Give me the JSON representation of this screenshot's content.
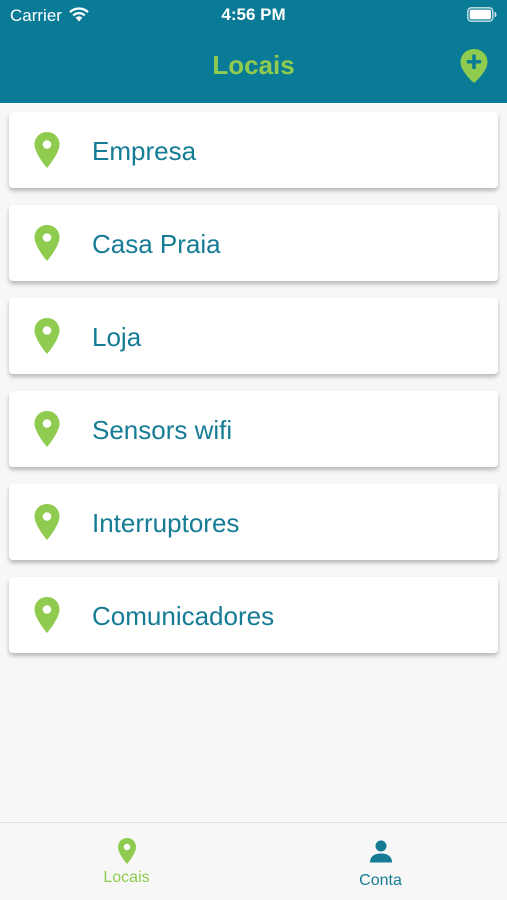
{
  "status_bar": {
    "carrier": "Carrier",
    "time": "4:56 PM",
    "icons": [
      "wifi-icon",
      "battery-icon"
    ]
  },
  "header": {
    "title": "Locais",
    "add_icon": "map-pin-plus-icon"
  },
  "locations": [
    {
      "label": "Empresa",
      "icon": "map-pin-icon"
    },
    {
      "label": "Casa Praia",
      "icon": "map-pin-icon"
    },
    {
      "label": "Loja",
      "icon": "map-pin-icon"
    },
    {
      "label": "Sensors wifi",
      "icon": "map-pin-icon"
    },
    {
      "label": "Interruptores",
      "icon": "map-pin-icon"
    },
    {
      "label": "Comunicadores",
      "icon": "map-pin-icon"
    }
  ],
  "tab_bar": {
    "tabs": [
      {
        "label": "Locais",
        "icon": "map-pin-icon",
        "selected": true
      },
      {
        "label": "Conta",
        "icon": "user-icon",
        "selected": false
      }
    ]
  },
  "colors": {
    "header_bg": "#0a7b97",
    "accent_green": "#8fcb4f",
    "text_teal": "#167c95",
    "background": "#f7f7f7"
  }
}
